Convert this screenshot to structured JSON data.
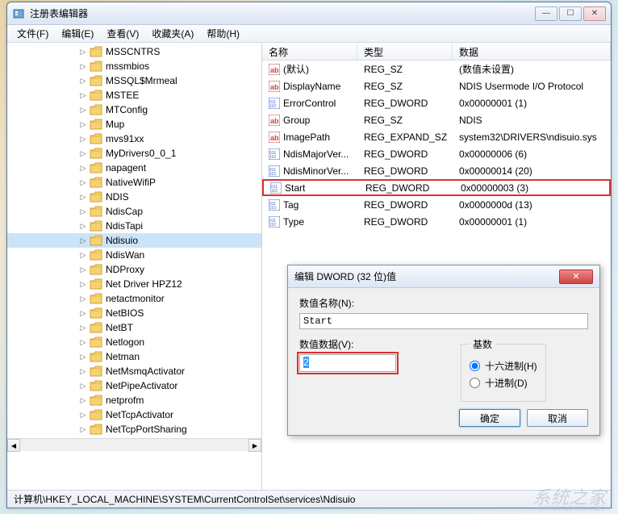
{
  "window": {
    "title": "注册表编辑器",
    "controls": {
      "min": "—",
      "max": "☐",
      "close": "✕"
    }
  },
  "menubar": [
    {
      "key": "file",
      "label": "文件(F)"
    },
    {
      "key": "edit",
      "label": "编辑(E)"
    },
    {
      "key": "view",
      "label": "查看(V)"
    },
    {
      "key": "favorites",
      "label": "收藏夹(A)"
    },
    {
      "key": "help",
      "label": "帮助(H)"
    }
  ],
  "tree": {
    "items": [
      {
        "label": "MSSCNTRS",
        "selected": false
      },
      {
        "label": "mssmbios",
        "selected": false
      },
      {
        "label": "MSSQL$Mrmeal",
        "selected": false
      },
      {
        "label": "MSTEE",
        "selected": false
      },
      {
        "label": "MTConfig",
        "selected": false
      },
      {
        "label": "Mup",
        "selected": false
      },
      {
        "label": "mvs91xx",
        "selected": false
      },
      {
        "label": "MyDrivers0_0_1",
        "selected": false
      },
      {
        "label": "napagent",
        "selected": false
      },
      {
        "label": "NativeWifiP",
        "selected": false
      },
      {
        "label": "NDIS",
        "selected": false
      },
      {
        "label": "NdisCap",
        "selected": false
      },
      {
        "label": "NdisTapi",
        "selected": false
      },
      {
        "label": "Ndisuio",
        "selected": true
      },
      {
        "label": "NdisWan",
        "selected": false
      },
      {
        "label": "NDProxy",
        "selected": false
      },
      {
        "label": "Net Driver HPZ12",
        "selected": false
      },
      {
        "label": "netactmonitor",
        "selected": false
      },
      {
        "label": "NetBIOS",
        "selected": false
      },
      {
        "label": "NetBT",
        "selected": false
      },
      {
        "label": "Netlogon",
        "selected": false
      },
      {
        "label": "Netman",
        "selected": false
      },
      {
        "label": "NetMsmqActivator",
        "selected": false
      },
      {
        "label": "NetPipeActivator",
        "selected": false
      },
      {
        "label": "netprofm",
        "selected": false
      },
      {
        "label": "NetTcpActivator",
        "selected": false
      },
      {
        "label": "NetTcpPortSharing",
        "selected": false
      }
    ]
  },
  "list": {
    "columns": {
      "name": "名称",
      "type": "类型",
      "data": "数据"
    },
    "rows": [
      {
        "icon": "ab",
        "name": "(默认)",
        "type": "REG_SZ",
        "data": "(数值未设置)",
        "highlight": false
      },
      {
        "icon": "ab",
        "name": "DisplayName",
        "type": "REG_SZ",
        "data": "NDIS Usermode I/O Protocol",
        "highlight": false
      },
      {
        "icon": "bin",
        "name": "ErrorControl",
        "type": "REG_DWORD",
        "data": "0x00000001 (1)",
        "highlight": false
      },
      {
        "icon": "ab",
        "name": "Group",
        "type": "REG_SZ",
        "data": "NDIS",
        "highlight": false
      },
      {
        "icon": "ab",
        "name": "ImagePath",
        "type": "REG_EXPAND_SZ",
        "data": "system32\\DRIVERS\\ndisuio.sys",
        "highlight": false
      },
      {
        "icon": "bin",
        "name": "NdisMajorVer...",
        "type": "REG_DWORD",
        "data": "0x00000006 (6)",
        "highlight": false
      },
      {
        "icon": "bin",
        "name": "NdisMinorVer...",
        "type": "REG_DWORD",
        "data": "0x00000014 (20)",
        "highlight": false
      },
      {
        "icon": "bin",
        "name": "Start",
        "type": "REG_DWORD",
        "data": "0x00000003 (3)",
        "highlight": true
      },
      {
        "icon": "bin",
        "name": "Tag",
        "type": "REG_DWORD",
        "data": "0x0000000d (13)",
        "highlight": false
      },
      {
        "icon": "bin",
        "name": "Type",
        "type": "REG_DWORD",
        "data": "0x00000001 (1)",
        "highlight": false
      }
    ]
  },
  "statusbar": {
    "path": "计算机\\HKEY_LOCAL_MACHINE\\SYSTEM\\CurrentControlSet\\services\\Ndisuio"
  },
  "dialog": {
    "title": "编辑 DWORD (32 位)值",
    "name_label": "数值名称(N):",
    "name_value": "Start",
    "data_label": "数值数据(V):",
    "data_value": "2",
    "base_label": "基数",
    "radix_hex": "十六进制(H)",
    "radix_dec": "十进制(D)",
    "ok": "确定",
    "cancel": "取消",
    "close": "✕"
  },
  "watermark": {
    "main": "系统之家",
    "sub": "XITONGZHIJIA.NET"
  }
}
